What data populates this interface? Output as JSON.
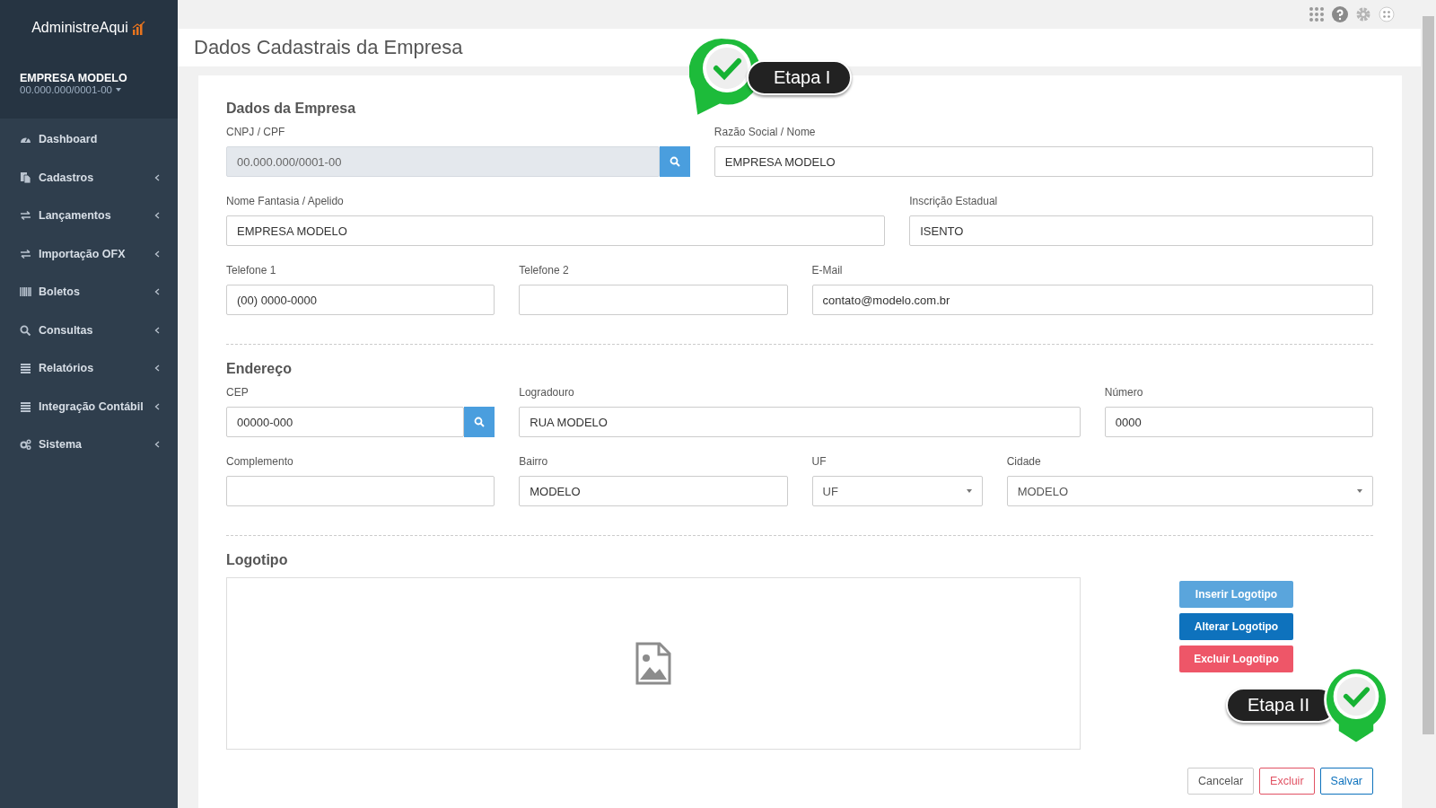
{
  "brand": {
    "name": "AdministreAqui"
  },
  "company": {
    "name": "EMPRESA MODELO",
    "document": "00.000.000/0001-00"
  },
  "sidebar": {
    "items": [
      {
        "label": "Dashboard",
        "has_submenu": false
      },
      {
        "label": "Cadastros",
        "has_submenu": true
      },
      {
        "label": "Lançamentos",
        "has_submenu": true
      },
      {
        "label": "Importação OFX",
        "has_submenu": true
      },
      {
        "label": "Boletos",
        "has_submenu": true
      },
      {
        "label": "Consultas",
        "has_submenu": true
      },
      {
        "label": "Relatórios",
        "has_submenu": true
      },
      {
        "label": "Integração Contábil",
        "has_submenu": true
      },
      {
        "label": "Sistema",
        "has_submenu": true
      }
    ]
  },
  "page": {
    "title": "Dados Cadastrais da Empresa"
  },
  "sections": [
    {
      "title": "Dados da Empresa",
      "rows": [
        [
          {
            "label": "CNPJ / CPF",
            "value": "00.000.000/0001-00",
            "kind": "search",
            "disabled": true
          },
          {
            "label": "Razão Social / Nome",
            "value": "EMPRESA MODELO",
            "kind": "text"
          }
        ],
        [
          {
            "label": "Nome Fantasia / Apelido",
            "value": "EMPRESA MODELO",
            "kind": "text"
          },
          {
            "label": "Inscrição Estadual",
            "value": "ISENTO",
            "kind": "text"
          }
        ],
        [
          {
            "label": "Telefone 1",
            "value": "(00) 0000-0000",
            "kind": "text"
          },
          {
            "label": "Telefone 2",
            "kind": "text"
          },
          {
            "label": "E-Mail",
            "value": "contato@modelo.com.br",
            "kind": "text"
          }
        ]
      ]
    },
    {
      "title": "Endereço",
      "rows": [
        [
          {
            "label": "CEP",
            "value": "00000-000",
            "kind": "search"
          },
          {
            "label": "Logradouro",
            "value": "RUA MODELO",
            "kind": "text"
          },
          {
            "label": "Número",
            "value": "0000",
            "kind": "text"
          }
        ],
        [
          {
            "label": "Complemento",
            "kind": "text"
          },
          {
            "label": "Bairro",
            "value": "MODELO",
            "kind": "text"
          },
          {
            "label": "UF",
            "value": "UF",
            "kind": "select"
          },
          {
            "label": "Cidade",
            "value": "MODELO",
            "kind": "select"
          }
        ]
      ]
    }
  ],
  "logo": {
    "title": "Logotipo",
    "buttons": [
      {
        "kind": "insert",
        "label": "Inserir Logotipo"
      },
      {
        "kind": "edit",
        "label": "Alterar Logotipo"
      },
      {
        "kind": "delete",
        "label": "Excluir Logotipo"
      }
    ]
  },
  "actions": [
    {
      "kind": "cancel",
      "label": "Cancelar"
    },
    {
      "kind": "delete",
      "label": "Excluir"
    },
    {
      "kind": "save",
      "label": "Salvar"
    }
  ],
  "callouts": [
    {
      "label": "Etapa I",
      "kind": "pin-left"
    },
    {
      "label": "Etapa II",
      "kind": "pin-right"
    }
  ]
}
